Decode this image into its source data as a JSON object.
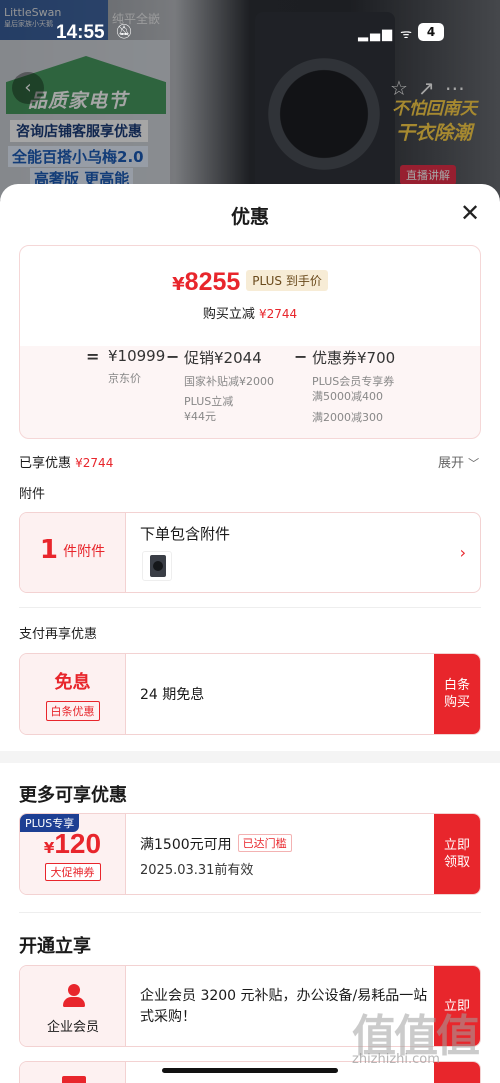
{
  "status_bar": {
    "time": "14:55",
    "battery": "4"
  },
  "background": {
    "logo": "LittleSwan",
    "logo_sub": "皇后家族小天鹅",
    "brand2": "纯平全嵌",
    "festival": "品质家电节",
    "line1": "咨询店铺客服享优惠",
    "line2": "全能百搭小乌梅2.0",
    "line3": "高奢版 更高能",
    "right_txt1": "不怕回南天",
    "right_txt2": "干衣除潮",
    "live_tag": "直播讲解"
  },
  "sheet": {
    "title": "优惠",
    "price_card": {
      "currency": "¥",
      "price": "8255",
      "plus_tag": "PLUS 到手价",
      "instant_label": "购买立减",
      "instant_amount": "¥2744",
      "equals": "=",
      "jd_price": "¥10999",
      "jd_price_label": "京东价",
      "minus1": "−",
      "promo_label": "促销",
      "promo_amount": "¥2044",
      "promo_sub1": "国家补贴减¥2000",
      "promo_sub2": "PLUS立减",
      "promo_sub3": "¥44元",
      "minus2": "−",
      "coupon_label": "优惠券",
      "coupon_amount": "¥700",
      "coupon_sub1": "PLUS会员专享券",
      "coupon_sub2": "满5000减400",
      "coupon_sub3": "满2000减300"
    },
    "enjoyed_label": "已享优惠",
    "enjoyed_amount": "¥2744",
    "expand_label": "展开",
    "accessory_section": "附件",
    "accessory_card": {
      "count": "1",
      "unit": "件附件",
      "title": "下单包含附件"
    },
    "pay_section": "支付再享优惠",
    "pay_card": {
      "title": "免息",
      "tag": "白条优惠",
      "desc": "24 期免息",
      "action": "白条购买"
    },
    "more_title": "更多可享优惠",
    "coupon_card": {
      "plus_corner": "PLUS专享",
      "currency": "¥",
      "amount": "120",
      "type_tag": "大促神券",
      "condition": "满1500元可用",
      "met_tag": "已达门槛",
      "valid": "2025.03.31前有效",
      "action": "立即领取"
    },
    "open_title": "开通立享",
    "member_card": {
      "label": "企业会员",
      "desc": "企业会员 3200 元补贴，办公设备/易耗品一站式采购！",
      "action": "立即"
    }
  },
  "watermark": {
    "main": "值值值",
    "sub": "zhizhizhi.com"
  },
  "colors": {
    "accent": "#e8262c",
    "plus_blue": "#1d3f93",
    "card_bg": "#fdf1f1"
  }
}
